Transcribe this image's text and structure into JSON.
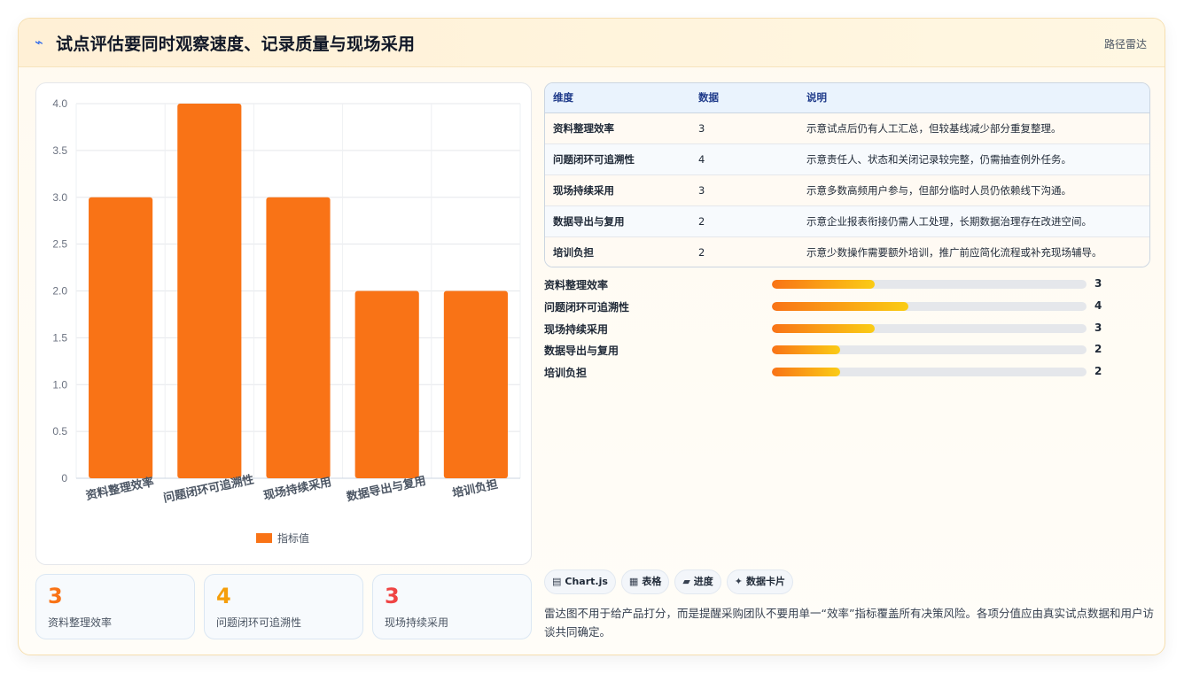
{
  "header": {
    "icon": "wave-icon",
    "title": "试点评估要同时观察速度、记录质量与现场采用",
    "tag": "路径雷达"
  },
  "chart_data": {
    "type": "bar",
    "categories": [
      "资料整理效率",
      "问题闭环可追溯性",
      "现场持续采用",
      "数据导出与复用",
      "培训负担"
    ],
    "series": [
      {
        "name": "指标值",
        "values": [
          3,
          4,
          3,
          2,
          2
        ],
        "color": "#f97316"
      }
    ],
    "ylim": [
      0,
      4
    ],
    "yticks": [
      "0",
      "0.5",
      "1.0",
      "1.5",
      "2.0",
      "2.5",
      "3.0",
      "3.5",
      "4.0"
    ],
    "grid": true,
    "legend": "bottom"
  },
  "stats": [
    {
      "value": "3",
      "label": "资料整理效率",
      "color": "#f97316"
    },
    {
      "value": "4",
      "label": "问题闭环可追溯性",
      "color": "#f59e0b"
    },
    {
      "value": "3",
      "label": "现场持续采用",
      "color": "#ef4444"
    }
  ],
  "table": {
    "headers": [
      "维度",
      "数据",
      "说明"
    ],
    "rows": [
      [
        "资料整理效率",
        "3",
        "示意试点后仍有人工汇总，但较基线减少部分重复整理。"
      ],
      [
        "问题闭环可追溯性",
        "4",
        "示意责任人、状态和关闭记录较完整，仍需抽查例外任务。"
      ],
      [
        "现场持续采用",
        "3",
        "示意多数高频用户参与，但部分临时人员仍依赖线下沟通。"
      ],
      [
        "数据导出与复用",
        "2",
        "示意企业报表衔接仍需人工处理，长期数据治理存在改进空间。"
      ],
      [
        "培训负担",
        "2",
        "示意少数操作需要额外培训，推广前应简化流程或补充现场辅导。"
      ]
    ]
  },
  "progress": {
    "max": 9.2,
    "items": [
      {
        "label": "资料整理效率",
        "value": 3
      },
      {
        "label": "问题闭环可追溯性",
        "value": 4
      },
      {
        "label": "现场持续采用",
        "value": 3
      },
      {
        "label": "数据导出与复用",
        "value": 2
      },
      {
        "label": "培训负担",
        "value": 2
      }
    ]
  },
  "chips": [
    {
      "icon": "chart-icon",
      "glyph": "▤",
      "label": "Chart.js"
    },
    {
      "icon": "table-icon",
      "glyph": "▦",
      "label": "表格"
    },
    {
      "icon": "progress-icon",
      "glyph": "▰",
      "label": "进度"
    },
    {
      "icon": "sparkle-icon",
      "glyph": "✦",
      "label": "数据卡片"
    }
  ],
  "note": "雷达图不用于给产品打分，而是提醒采购团队不要用单一“效率”指标覆盖所有决策风险。各项分值应由真实试点数据和用户访谈共同确定。"
}
